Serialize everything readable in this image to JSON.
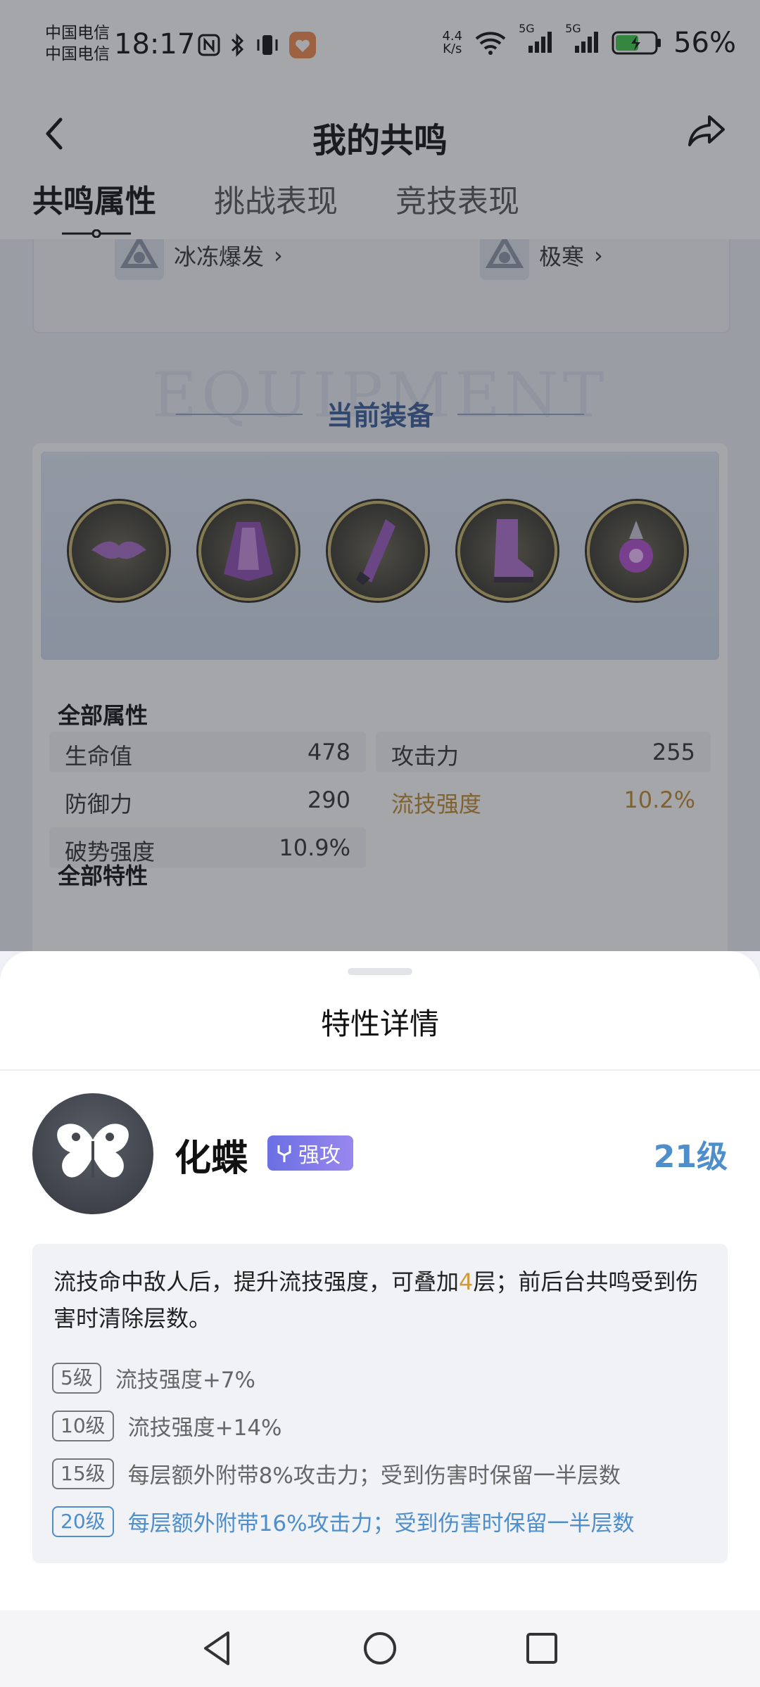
{
  "status_bar": {
    "carrier_1": "中国电信",
    "carrier_2": "中国电信",
    "time": "18:17",
    "net_speed_top": "4.4",
    "net_speed_bottom": "K/s",
    "signal_label_1": "5G",
    "signal_label_2": "5G",
    "battery": "56%"
  },
  "header": {
    "title": "我的共鸣",
    "tabs": [
      "共鸣属性",
      "挑战表现",
      "竞技表现"
    ],
    "active_tab": 0
  },
  "elements": [
    "冰冻爆发",
    "极寒"
  ],
  "equipment": {
    "watermark": "EQUIPMENT",
    "title": "当前装备",
    "items": [
      "mask-icon",
      "cloak-icon",
      "gauntlet-icon",
      "boot-icon",
      "orb-icon"
    ]
  },
  "attributes": {
    "title": "全部属性",
    "items": [
      {
        "name": "生命值",
        "value": "478"
      },
      {
        "name": "攻击力",
        "value": "255"
      },
      {
        "name": "防御力",
        "value": "290"
      },
      {
        "name": "流技强度",
        "value": "10.2%"
      },
      {
        "name": "破势强度",
        "value": "10.9%"
      }
    ]
  },
  "traits_title": "全部特性",
  "sheet": {
    "title": "特性详情",
    "trait_name": "化蝶",
    "tag_label": "强攻",
    "level": "21级",
    "desc_before": "流技命中敌人后，提升流技强度，可叠加",
    "desc_number": "4",
    "desc_after": "层；前后台共鸣受到伤害时清除层数。",
    "levels": [
      {
        "badge": "5级",
        "text": "流技强度+7%"
      },
      {
        "badge": "10级",
        "text": "流技强度+14%"
      },
      {
        "badge": "15级",
        "text": "每层额外附带8%攻击力；受到伤害时保留一半层数"
      },
      {
        "badge": "20级",
        "text": "每层额外附带16%攻击力；受到伤害时保留一半层数"
      }
    ]
  },
  "colors": {
    "accent_blue": "#4e8ecb",
    "highlight_gold": "#c08a2c",
    "tag_purple": "#7b79e8"
  }
}
